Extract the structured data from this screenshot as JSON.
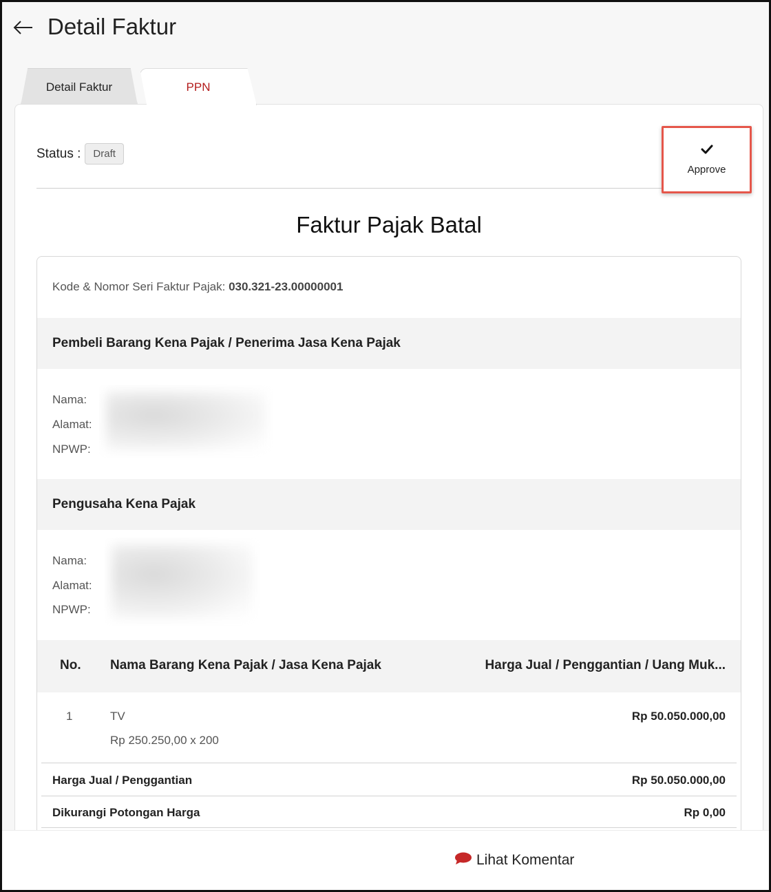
{
  "header": {
    "title": "Detail Faktur",
    "back_icon": "arrow-left-icon"
  },
  "tabs": [
    {
      "label": "Detail Faktur",
      "active": false
    },
    {
      "label": "PPN",
      "active": true
    }
  ],
  "status": {
    "label": "Status :",
    "value": "Draft"
  },
  "approve": {
    "label": "Approve",
    "icon": "check-icon"
  },
  "document": {
    "title": "Faktur Pajak Batal",
    "serial_label": "Kode & Nomor Seri Faktur Pajak:",
    "serial_value": "030.321-23.00000001",
    "buyer": {
      "heading": "Pembeli Barang Kena Pajak / Penerima Jasa Kena Pajak",
      "name_label": "Nama:",
      "address_label": "Alamat:",
      "npwp_label": "NPWP:"
    },
    "seller": {
      "heading": "Pengusaha Kena Pajak",
      "name_label": "Nama:",
      "address_label": "Alamat:",
      "npwp_label": "NPWP:"
    },
    "table": {
      "columns": [
        "No.",
        "Nama Barang Kena Pajak / Jasa Kena Pajak",
        "Harga Jual / Penggantian / Uang Muk..."
      ],
      "rows": [
        {
          "no": "1",
          "name": "TV",
          "detail": "Rp 250.250,00 x 200",
          "amount": "Rp 50.050.000,00"
        }
      ]
    },
    "summary": [
      {
        "label": "Harga Jual / Penggantian",
        "value": "Rp 50.050.000,00"
      },
      {
        "label": "Dikurangi Potongan Harga",
        "value": "Rp 0,00"
      }
    ]
  },
  "footer": {
    "comment_label": "Lihat Komentar",
    "comment_icon": "chat-bubble-icon",
    "accent": "#c62828"
  },
  "colors": {
    "tab_active": "#b31b1b",
    "highlight_border": "#e5564a"
  }
}
